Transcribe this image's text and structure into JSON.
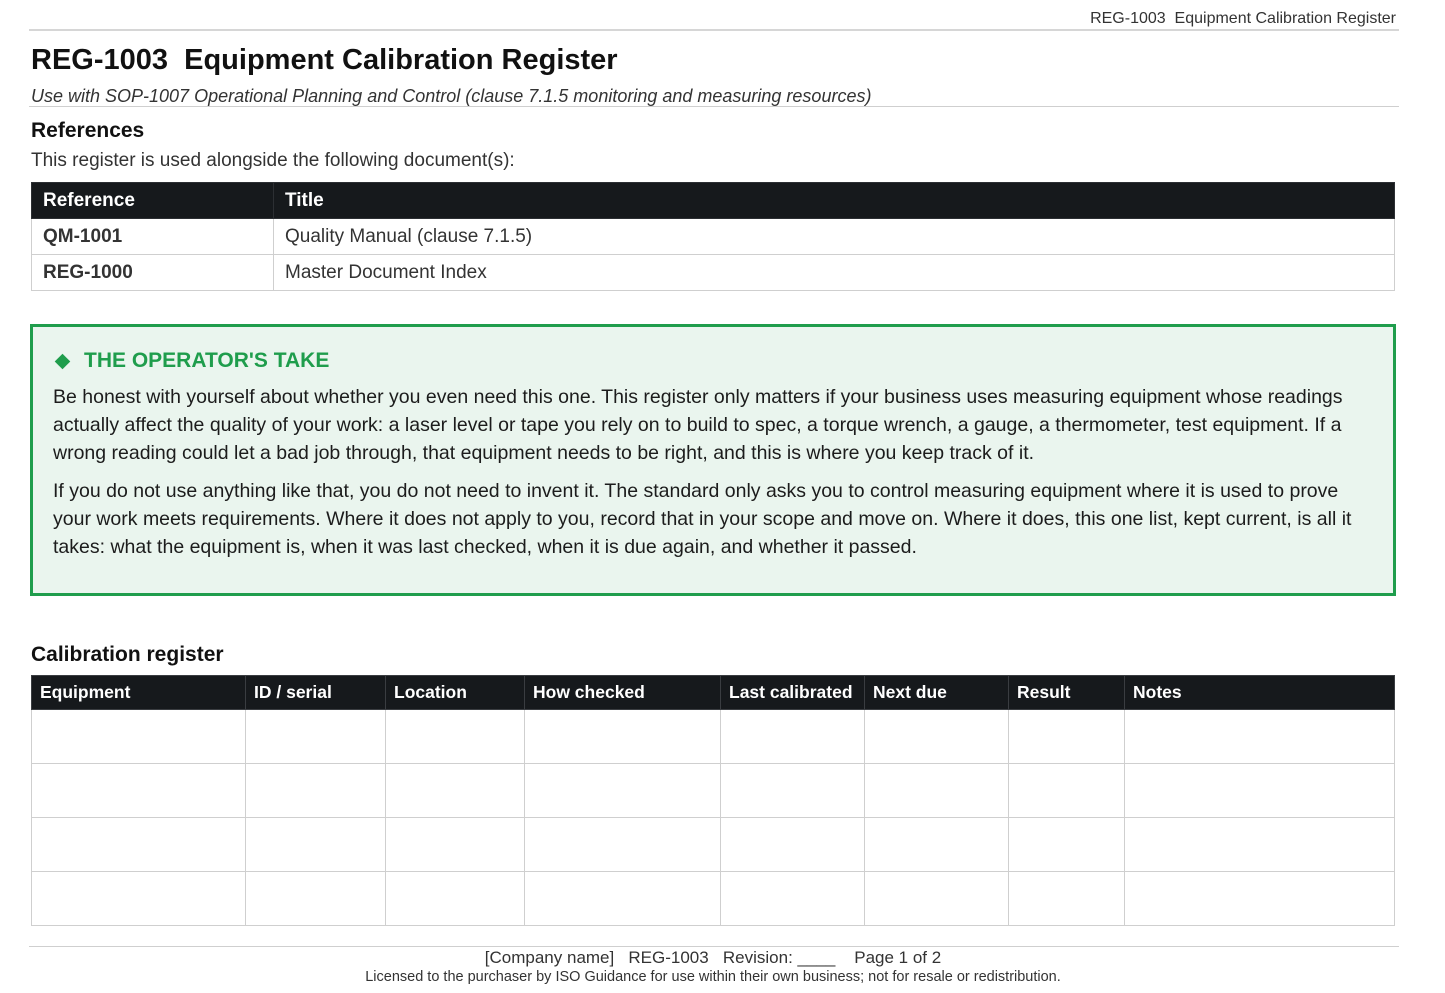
{
  "running_header": "REG-1003  Equipment Calibration Register",
  "title": "REG-1003  Equipment Calibration Register",
  "subtitle": "Use with SOP-1007 Operational Planning and Control (clause 7.1.5 monitoring and measuring resources)",
  "references": {
    "heading": "References",
    "intro": "This register is used alongside the following document(s):",
    "columns": [
      "Reference",
      "Title"
    ],
    "rows": [
      {
        "reference": "QM-1001",
        "title": "Quality Manual (clause 7.1.5)"
      },
      {
        "reference": "REG-1000",
        "title": "Master Document Index"
      }
    ]
  },
  "callout": {
    "icon": "diamond-icon",
    "title": "THE OPERATOR'S TAKE",
    "paragraphs": [
      "Be honest with yourself about whether you even need this one. This register only matters if your business uses measuring equipment whose readings actually affect the quality of your work: a laser level or tape you rely on to build to spec, a torque wrench, a gauge, a thermometer, test equipment. If a wrong reading could let a bad job through, that equipment needs to be right, and this is where you keep track of it.",
      "If you do not use anything like that, you do not need to invent it. The standard only asks you to control measuring equipment where it is used to prove your work meets requirements. Where it does not apply to you, record that in your scope and move on. Where it does, this one list, kept current, is all it takes: what the equipment is, when it was last checked, when it is due again, and whether it passed."
    ],
    "colors": {
      "accent": "#1f9d4c",
      "background": "#eaf5ee"
    }
  },
  "calibration": {
    "heading": "Calibration register",
    "columns": [
      "Equipment",
      "ID / serial",
      "Location",
      "How checked",
      "Last calibrated",
      "Next due",
      "Result",
      "Notes"
    ],
    "blank_rows": 4
  },
  "footer": {
    "line": "[Company name]   REG-1003   Revision: ____    Page 1 of 2",
    "licence": "Licensed to the purchaser by ISO Guidance for use within their own business; not for resale or redistribution."
  },
  "colors": {
    "table_header": "#16191c",
    "rule": "#cfcfcf"
  }
}
